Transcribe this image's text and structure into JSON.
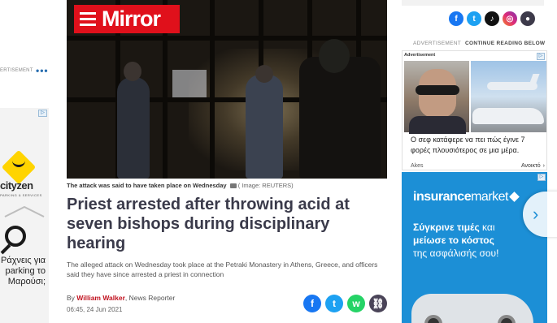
{
  "brand": {
    "name": "Mirror",
    "color": "#e0101b"
  },
  "left_rail": {
    "ad_label": "ERTISEMENT",
    "cityzen": {
      "word": "cityzen",
      "tagline": "PARKING & SERVICES"
    },
    "promo_text": "Ράχνεις για parking το Μαρούσι;"
  },
  "article": {
    "image_caption": "The attack was said to have taken place on Wednesday",
    "image_credit": "( Image: REUTERS)",
    "headline": "Priest arrested after throwing acid at seven bishops during disciplinary hearing",
    "standfirst": "The alleged attack on Wednesday took place at the Petraki Monastery in Athens, Greece, and officers said they have since arrested a priest in connection",
    "byline_prefix": "By",
    "author": "William Walker",
    "author_role": ", News Reporter",
    "timestamp": "06:45, 24 Jun 2021",
    "share": [
      {
        "name": "facebook",
        "glyph": "f"
      },
      {
        "name": "twitter",
        "glyph": "t"
      },
      {
        "name": "whatsapp",
        "glyph": "w"
      },
      {
        "name": "copy-link",
        "glyph": "⛓"
      }
    ]
  },
  "social_header": [
    {
      "name": "facebook",
      "glyph": "f"
    },
    {
      "name": "twitter",
      "glyph": "t"
    },
    {
      "name": "tiktok",
      "glyph": "♪"
    },
    {
      "name": "instagram",
      "glyph": "◎"
    },
    {
      "name": "account",
      "glyph": "●"
    }
  ],
  "right_rail": {
    "ad_header": "ADVERTISEMENT",
    "continue_reading": "CONTINUE READING BELOW",
    "ad1": {
      "label": "Advertisement",
      "text": "Ο σεφ κατάφερε να πει πώς έγινε 7 φορές πλουσιότερος σε μια μέρα.",
      "source": "Akes",
      "open_label": "Ανοικτό"
    },
    "ad2": {
      "logo_bold": "insurance",
      "logo_light": "market",
      "tag_line1_bold": "Σύγκρινε τιμές",
      "tag_line1_rest": " και",
      "tag_line2_bold": "μείωσε το κόστος",
      "tag_line3": "της ασφάλισής σου!"
    }
  }
}
